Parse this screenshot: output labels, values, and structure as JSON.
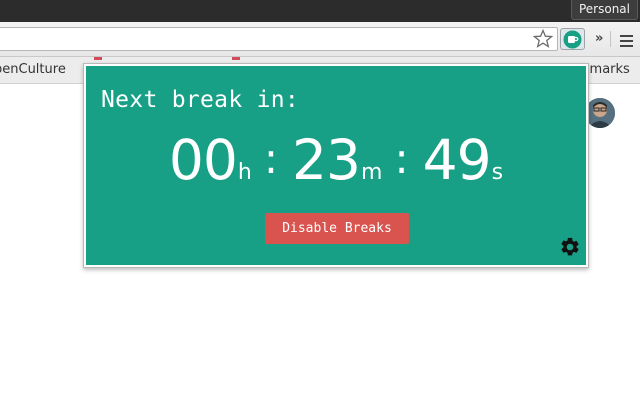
{
  "browser": {
    "profile_label": "Personal",
    "bookmarks": {
      "left_item": "penCulture",
      "right_item": "kmarks"
    },
    "icons": {
      "star": "star-icon",
      "extension": "coffee-cup-icon",
      "more": "chevron-double-right-icon",
      "menu": "hamburger-menu-icon"
    }
  },
  "popup": {
    "heading": "Next break in:",
    "timer": {
      "hours": "00",
      "hours_unit": "h",
      "minutes": "23",
      "minutes_unit": "m",
      "seconds": "49",
      "seconds_unit": "s",
      "separator": ":"
    },
    "disable_button_label": "Disable Breaks",
    "settings_icon": "gear-icon"
  },
  "colors": {
    "popup_bg": "#17a086",
    "button_bg": "#d9534f",
    "text": "#ffffff"
  }
}
